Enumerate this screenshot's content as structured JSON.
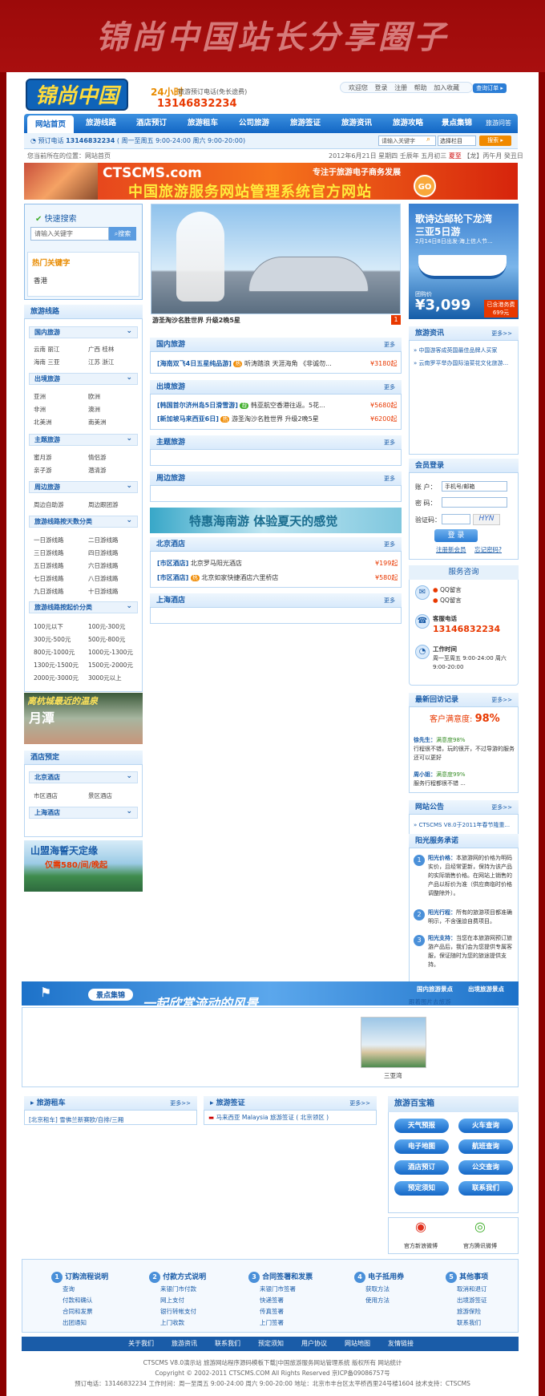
{
  "banner": {
    "title": "锦尚中国站长分享圈子"
  },
  "header": {
    "logo": "锦尚中国",
    "tag24": "24小时",
    "hotline_label": "旅游预订电话(免长途费)",
    "hotline_number": "13146832234",
    "toplinks": [
      "欢迎您",
      "登录",
      "注册",
      "帮助",
      "加入收藏"
    ],
    "order_btn": "查询订单 ▸"
  },
  "nav": {
    "items": [
      "网站首页",
      "旅游线路",
      "酒店预订",
      "旅游租车",
      "公司旅游",
      "旅游签证",
      "旅游资讯",
      "旅游攻略",
      "景点集锦",
      "旅游问答"
    ]
  },
  "subbar": {
    "phone_label": "预订电话",
    "phone": "13146832234",
    "hours": "( 周一至周五 9:00-24:00 周六 9:00-20:00)",
    "search_placeholder": "请输入关键字",
    "select_value": "选择栏目",
    "search_btn": "搜索 ▸"
  },
  "crumb": "您当前所在的位置：网站首页",
  "date": {
    "main": "2012年6月21日 星期四 壬辰年 五月初三",
    "highlight": "夏至",
    "tail": "【龙】丙午月 癸丑日"
  },
  "ad": {
    "brand": "CTSCMS.com",
    "slogan": "专注于旅游电子商务发展",
    "main": "中国旅游服务网站管理系统官方网站",
    "go": "GO"
  },
  "left": {
    "qsearch_title": "快速搜索",
    "qsearch_placeholder": "请输入关键字",
    "qsearch_btn": "搜索",
    "hot_title": "热门关键字",
    "hot_item": "香港",
    "routes_title": "旅游线路",
    "groups": [
      {
        "title": "国内旅游",
        "cells": [
          "云南 丽江",
          "广西 桂林",
          "海南 三亚",
          "江苏 浙江"
        ]
      },
      {
        "title": "出境旅游",
        "cells": [
          "亚洲",
          "欧洲",
          "非洲",
          "澳洲",
          "北美洲",
          "南美洲"
        ]
      },
      {
        "title": "主题旅游",
        "cells": [
          "蜜月游",
          "情侣游",
          "亲子游",
          "潜清游"
        ]
      },
      {
        "title": "周边旅游",
        "cells": [
          "周边自助游",
          "周边跟团游"
        ]
      },
      {
        "title": "旅游线路按天数分类",
        "cells": [
          "一日游线路",
          "二日游线路",
          "三日游线路",
          "四日游线路",
          "五日游线路",
          "六日游线路",
          "七日游线路",
          "八日游线路",
          "九日游线路",
          "十日游线路"
        ]
      },
      {
        "title": "旅游线路按起价分类",
        "cells": [
          "100元以下",
          "100元-300元",
          "300元-500元",
          "500元-800元",
          "800元-1000元",
          "1000元-1300元",
          "1300元-1500元",
          "1500元-2000元",
          "2000元-3000元",
          "3000元以上"
        ]
      }
    ],
    "ad1_text": "离杭城最近的温泉",
    "ad1_sub": "月潭",
    "hotel_title": "酒店预定",
    "hotel_groups": [
      {
        "title": "北京酒店",
        "cells": [
          "市区酒店",
          "景区酒店"
        ]
      },
      {
        "title": "上海酒店",
        "cells": []
      }
    ],
    "ad2_text": "山盟海誓天定缘",
    "ad2_price": "仅需580/间/晚起"
  },
  "center": {
    "slide_caption": "游圣淘沙名胜世界  升级2晚5星",
    "slide_num": "1",
    "sections": [
      {
        "title": "国内旅游",
        "more": "更多",
        "items": [
          {
            "tag": "[海南双飞4日五星纯品游]",
            "text": "听涛踏浪  天涯海角  《非诚勿...",
            "price": "¥3180起"
          }
        ]
      },
      {
        "title": "出境旅游",
        "more": "更多",
        "items": [
          {
            "tag": "[韩国首尔济州岛5日滑雪游]",
            "text": "韩亚航空香港往返。5花...",
            "price": "¥5680起"
          },
          {
            "tag": "[新加坡马来西亚6日]",
            "text": "游圣淘沙名胜世界 升级2晚5星",
            "price": "¥6200起"
          }
        ]
      },
      {
        "title": "主题旅游",
        "more": "更多",
        "items": []
      },
      {
        "title": "周边旅游",
        "more": "更多",
        "items": []
      }
    ],
    "hainan_ad": "特惠海南游 体验夏天的感觉",
    "hotel_sections": [
      {
        "title": "北京酒店",
        "more": "更多",
        "items": [
          {
            "tag": "[市区酒店]",
            "text": "北京罗马阳光酒店",
            "price": "¥199起"
          },
          {
            "tag": "[市区酒店]",
            "text": "北京如家快捷酒店六里桥店",
            "price": "¥580起"
          }
        ]
      },
      {
        "title": "上海酒店",
        "more": "更多",
        "items": []
      }
    ]
  },
  "right": {
    "promo_title1": "歌诗达邮轮下龙湾",
    "promo_title2": "三亚5日游",
    "promo_sub": "2月14日8日出发·海上信人节...",
    "promo_label": "团购价",
    "promo_price": "¥3,099",
    "promo_badge": "已含港务费699元",
    "news_title": "旅游资讯",
    "news_more": "更多>>",
    "news_items": [
      "中国游客成英国最佳品牌人买家",
      "云南罗平举办国际油菜花文化旅游..."
    ],
    "login_title": "会员登录",
    "account_label": "账  户：",
    "account_placeholder": "手机号/邮箱",
    "password_label": "密  码：",
    "captcha_label": "验证码：",
    "login_btn": "登  录",
    "register_link": "注册新会员",
    "forgot_link": "忘记密码?",
    "consult_title": "服务咨询",
    "qq1": "QQ留言",
    "qq2": "QQ留言",
    "phone_label": "客服电话",
    "phone": "13146832234",
    "work_label": "工作时间",
    "work_hours": "周一至周五 9:00-24:00 周六 9:00-20:00",
    "review_title": "最新回访记录",
    "review_more": "更多>>",
    "satisfaction_label": "客户满意度:",
    "satisfaction_value": "98%",
    "reviews": [
      {
        "name": "徐先生：",
        "score": "满意度98%",
        "text": "行程很不错，玩的很开，不过导游的服务还可以更好"
      },
      {
        "name": "周小姐：",
        "score": "满意度99%",
        "text": "服务行程都很不错 ..."
      }
    ],
    "notice_title": "网站公告",
    "notice_more": "更多>>",
    "notice_item": "CTSCMS V8.0于2011年春节隆重...",
    "promise_title": "阳光服务承诺",
    "promises": [
      {
        "num": "1",
        "title": "阳光价格：",
        "text": "本旅游网的价格为明码实价，且经常更新，保持为该产品的实际销售价格。在网站上销售的产品以标价为准（供应商临时价格调整除外）。"
      },
      {
        "num": "2",
        "title": "阳光行程：",
        "text": "所有的旅游项目都准确明示，不含强迫自费项目。"
      },
      {
        "num": "3",
        "title": "阳光支持：",
        "text": "当您在本旅游网预订旅游产品后，我们会为您提供专属客服，保证随时为您的旅途提供支持。"
      }
    ]
  },
  "scenic": {
    "title": "景点集锦",
    "slogan": "一起欣赏流动的风景",
    "tabs": [
      "国内旅游景点",
      "出境旅游景点"
    ],
    "sub_link": "跟着图片去旅游",
    "photo_caption": "三亚湾"
  },
  "bottom": {
    "car_title": "旅游租车",
    "car_more": "更多>>",
    "car_item": "[北京租车] 雪佛兰新赛欧/自排/三厢",
    "visa_title": "旅游签证",
    "visa_more": "更多>>",
    "visa_item": "马来西亚 Malaysia 旅游签证 ( 北京领区 )",
    "toolbox_title": "旅游百宝箱",
    "toolbox_btns": [
      "天气预报",
      "火车查询",
      "电子地图",
      "航班查询",
      "酒店预订",
      "公交查询",
      "预定须知",
      "联系我们"
    ],
    "weibo1": "官方新浪微博",
    "weibo2": "官方腾讯微博"
  },
  "footer": {
    "cols": [
      {
        "num": "1",
        "title": "订购流程说明",
        "items": [
          "查询",
          "付款和确认",
          "合同和发票",
          "出团通知"
        ]
      },
      {
        "num": "2",
        "title": "付款方式说明",
        "items": [
          "来银门市付款",
          "网上支付",
          "银行转帐支付",
          "上门收款"
        ]
      },
      {
        "num": "3",
        "title": "合同签署和发票",
        "items": [
          "来银门市签署",
          "快递签署",
          "传真签署",
          "上门签署"
        ]
      },
      {
        "num": "4",
        "title": "电子抵用券",
        "items": [
          "获取方法",
          "使用方法"
        ]
      },
      {
        "num": "5",
        "title": "其他事项",
        "items": [
          "取消和退订",
          "出境游签证",
          "旅游保险",
          "联系我们"
        ]
      }
    ],
    "nav": [
      "关于我们",
      "旅游资讯",
      "联系我们",
      "预定须知",
      "用户协议",
      "网站地图",
      "友情链接"
    ],
    "line1": "CTSCMS V8.0演示站  旅游网站程序源码模板下载|中国旅游服务网站管理系统  版权所有  网站统计",
    "line2": "Copyright © 2002-2011 CTSCMS.COM All Rights Reserved 京ICP备09086757号",
    "line3": "预订电话：13146832234    工作时间：周一至周五 9:00-24:00 周六 9:00-20:00    地址：北京市丰台区太平桥西里24号楼1604 技术支持：CTSCMS"
  }
}
